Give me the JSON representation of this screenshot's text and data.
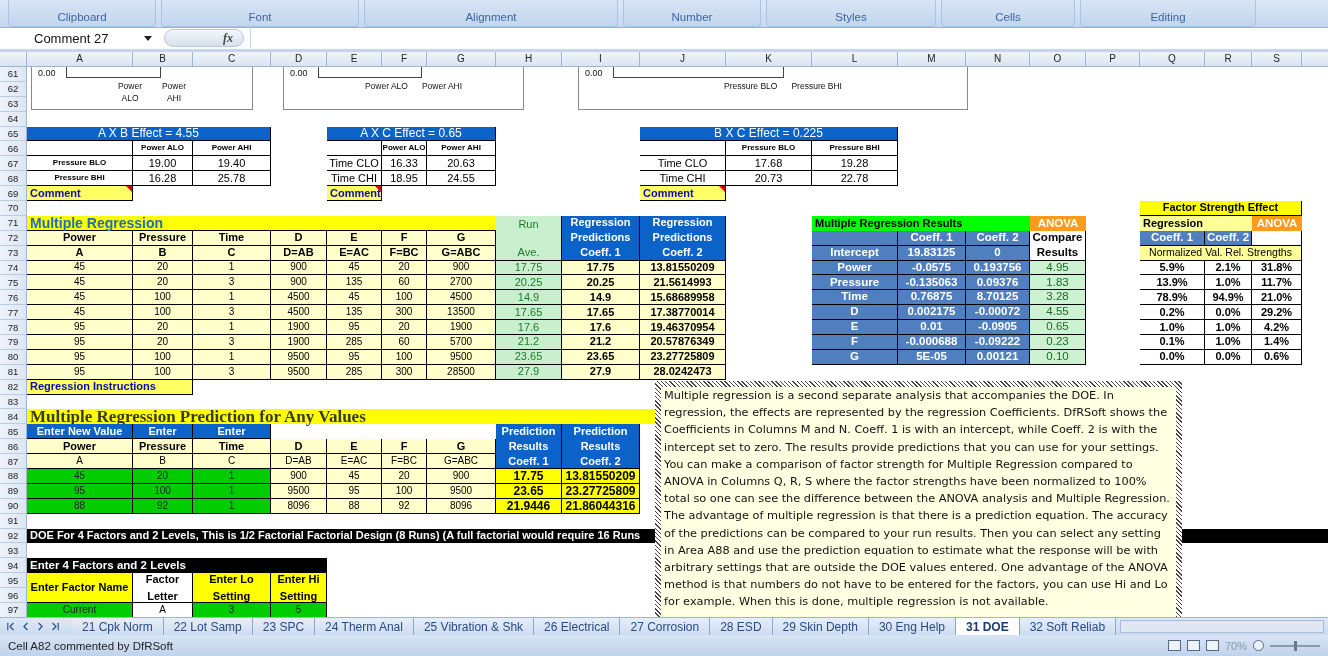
{
  "ribbon": {
    "groups": [
      "Clipboard",
      "Font",
      "Alignment",
      "Number",
      "Styles",
      "Cells",
      "Editing"
    ]
  },
  "formula_bar": {
    "name_box": "Comment 27",
    "fx_label": "fx"
  },
  "column_headers": [
    "A",
    "B",
    "C",
    "D",
    "E",
    "F",
    "G",
    "H",
    "I",
    "J",
    "K",
    "L",
    "M",
    "N",
    "O",
    "P",
    "Q",
    "R",
    "S"
  ],
  "row_numbers": [
    "61",
    "62",
    "63",
    "64",
    "65",
    "66",
    "67",
    "68",
    "69",
    "70",
    "71",
    "72",
    "73",
    "74",
    "75",
    "76",
    "77",
    "78",
    "79",
    "80",
    "81",
    "82",
    "83",
    "84",
    "85",
    "86",
    "87",
    "88",
    "89",
    "90",
    "91",
    "92",
    "93",
    "94",
    "95",
    "96",
    "97"
  ],
  "charts": [
    {
      "axis_value": "0.00",
      "x_labels": [
        "Power ALO",
        "Power AHI"
      ]
    },
    {
      "axis_value": "0.00",
      "x_labels": [
        "Power ALO",
        "Power AHI"
      ]
    },
    {
      "axis_value": "0.00",
      "x_labels": [
        "Pressure BLO",
        "Pressure BHI"
      ]
    }
  ],
  "effect_tables": [
    {
      "title": "A X B Effect = 4.55",
      "columns": [
        "Power ALO",
        "Power AHI"
      ],
      "rows": [
        {
          "label": "Pressure BLO",
          "values": [
            "19.00",
            "19.40"
          ]
        },
        {
          "label": "Pressure BHI",
          "values": [
            "16.28",
            "25.78"
          ]
        }
      ],
      "comment": "Comment"
    },
    {
      "title": "A X C Effect = 0.65",
      "columns": [
        "Power ALO",
        "Power AHI"
      ],
      "rows": [
        {
          "label": "Time CLO",
          "values": [
            "16.33",
            "20.63"
          ]
        },
        {
          "label": "Time CHI",
          "values": [
            "18.95",
            "24.55"
          ]
        }
      ],
      "comment": "Comment"
    },
    {
      "title": "B X C Effect = 0.225",
      "columns": [
        "Pressure BLO",
        "Pressure BHI"
      ],
      "rows": [
        {
          "label": "Time CLO",
          "values": [
            "17.68",
            "19.28"
          ]
        },
        {
          "label": "Time CHI",
          "values": [
            "20.73",
            "22.78"
          ]
        }
      ],
      "comment": "Comment"
    }
  ],
  "multiple_regression": {
    "title": "Multiple Regression",
    "run_header": [
      "Run",
      "Ave."
    ],
    "prediction_headers": [
      "Regression Predictions Coeff. 1",
      "Regression Predictions Coeff. 2"
    ],
    "factor_names": [
      "Power",
      "Pressure",
      "Time",
      "D",
      "E",
      "F",
      "G"
    ],
    "factor_codes": [
      "A",
      "B",
      "C",
      "D=AB",
      "E=AC",
      "F=BC",
      "G=ABC"
    ],
    "rows": [
      {
        "values": [
          "45",
          "20",
          "1",
          "900",
          "45",
          "20",
          "900"
        ],
        "run_ave": "17.75",
        "coeff_1": "17.75",
        "coeff_2": "13.81550209"
      },
      {
        "values": [
          "45",
          "20",
          "3",
          "900",
          "135",
          "60",
          "2700"
        ],
        "run_ave": "20.25",
        "coeff_1": "20.25",
        "coeff_2": "21.5614993"
      },
      {
        "values": [
          "45",
          "100",
          "1",
          "4500",
          "45",
          "100",
          "4500"
        ],
        "run_ave": "14.9",
        "coeff_1": "14.9",
        "coeff_2": "15.68689958"
      },
      {
        "values": [
          "45",
          "100",
          "3",
          "4500",
          "135",
          "300",
          "13500"
        ],
        "run_ave": "17.65",
        "coeff_1": "17.65",
        "coeff_2": "17.38770014"
      },
      {
        "values": [
          "95",
          "20",
          "1",
          "1900",
          "95",
          "20",
          "1900"
        ],
        "run_ave": "17.6",
        "coeff_1": "17.6",
        "coeff_2": "19.46370954"
      },
      {
        "values": [
          "95",
          "20",
          "3",
          "1900",
          "285",
          "60",
          "5700"
        ],
        "run_ave": "21.2",
        "coeff_1": "21.2",
        "coeff_2": "20.57876349"
      },
      {
        "values": [
          "95",
          "100",
          "1",
          "9500",
          "95",
          "100",
          "9500"
        ],
        "run_ave": "23.65",
        "coeff_1": "23.65",
        "coeff_2": "23.27725809"
      },
      {
        "values": [
          "95",
          "100",
          "3",
          "9500",
          "285",
          "300",
          "28500"
        ],
        "run_ave": "27.9",
        "coeff_1": "27.9",
        "coeff_2": "28.0242473"
      }
    ],
    "instructions": "Regression Instructions"
  },
  "regression_results": {
    "title": "Multiple Regression Results",
    "anova": "ANOVA",
    "columns": [
      "Coeff. 1",
      "Coeff. 2"
    ],
    "compare": "Compare Results",
    "rows": [
      {
        "label": "Intercept",
        "coeff_1": "19.83125",
        "coeff_2": "0"
      },
      {
        "label": "Power",
        "coeff_1": "-0.0575",
        "coeff_2": "0.193756",
        "anova": "4.95"
      },
      {
        "label": "Pressure",
        "coeff_1": "-0.135063",
        "coeff_2": "0.09376",
        "anova": "1.83"
      },
      {
        "label": "Time",
        "coeff_1": "0.76875",
        "coeff_2": "8.70125",
        "anova": "3.28"
      },
      {
        "label": "D",
        "coeff_1": "0.002175",
        "coeff_2": "-0.00072",
        "anova": "4.55"
      },
      {
        "label": "E",
        "coeff_1": "0.01",
        "coeff_2": "-0.0905",
        "anova": "0.65"
      },
      {
        "label": "F",
        "coeff_1": "-0.000688",
        "coeff_2": "-0.09222",
        "anova": "0.23"
      },
      {
        "label": "G",
        "coeff_1": "5E-05",
        "coeff_2": "0.00121",
        "anova": "0.10"
      }
    ]
  },
  "factor_strength": {
    "title": "Factor Strength Effect",
    "regression": "Regression",
    "anova": "ANOVA",
    "columns": [
      "Coeff. 1",
      "Coeff. 2"
    ],
    "note": "Normalized Val. Rel. Strengths",
    "rows": [
      [
        "5.9%",
        "2.1%",
        "31.8%"
      ],
      [
        "13.9%",
        "1.0%",
        "11.7%"
      ],
      [
        "78.9%",
        "94.9%",
        "21.0%"
      ],
      [
        "0.2%",
        "0.0%",
        "29.2%"
      ],
      [
        "1.0%",
        "1.0%",
        "4.2%"
      ],
      [
        "0.1%",
        "1.0%",
        "1.4%"
      ],
      [
        "0.0%",
        "0.0%",
        "0.6%"
      ]
    ]
  },
  "prediction": {
    "title": "Multiple Regression Prediction for Any Values",
    "enter_headers": [
      "Enter New Value",
      "Enter",
      "Enter"
    ],
    "factor_names": [
      "Power",
      "Pressure",
      "Time",
      "D",
      "E",
      "F",
      "G"
    ],
    "factor_codes": [
      "A",
      "B",
      "C",
      "D=AB",
      "E=AC",
      "F=BC",
      "G=ABC"
    ],
    "result_headers": [
      "Prediction Results Coeff. 1",
      "Prediction Results Coeff. 2"
    ],
    "rows": [
      {
        "values": [
          "45",
          "20",
          "1",
          "900",
          "45",
          "20",
          "900"
        ],
        "coeff_1": "17.75",
        "coeff_2": "13.81550209"
      },
      {
        "values": [
          "95",
          "100",
          "1",
          "9500",
          "95",
          "100",
          "9500"
        ],
        "coeff_1": "23.65",
        "coeff_2": "23.27725809"
      },
      {
        "values": [
          "88",
          "92",
          "1",
          "8096",
          "88",
          "92",
          "8096"
        ],
        "coeff_1": "21.9446",
        "coeff_2": "21.86044316"
      }
    ]
  },
  "doe_banner": "DOE For 4 Factors and 2 Levels, This is  1/2 Factorial Factorial Design (8 Runs) (A full factorial would require 16 Runs",
  "factors_table": {
    "title": "Enter 4 Factors and 2 Levels",
    "headers": [
      "Enter Factor Name",
      "Factor Letter",
      "Enter Lo Setting",
      "Enter Hi Setting"
    ],
    "rows": [
      {
        "name": "Current",
        "letter": "A",
        "lo": "3",
        "hi": "5"
      }
    ]
  },
  "comment_box": {
    "text": "Multiple regression is a second separate analysis that accompanies the DOE. In regression, the effects are represented by the regression Coefficients. DfRSoft shows the Coefficients in Columns M and N. Coeff. 1 is with an intercept, while Coeff. 2 is with the intercept set to zero. The results provide predictions that you can use for your settings. You can make a comparison of factor strength for Multiple Regression compared to ANOVA in Columns Q, R, S where the factor strengths have been normalized to 100% total so one can see the difference between the ANOVA analysis and Multiple Regression. The advantage of multiple regression is that there is a prediction equation. The accuracy of the predictions can be compared to your run results. Then you can select any setting in Area A88 and use the prediction equation to estimate what the response will be with arbitrary settings that are outside the DOE values entered. One advantage of the ANOVA method is that numbers do not have to be entered for the factors, you can use Hi and Lo for example. When this is done, multiple regression is not available."
  },
  "sheet_tabs": [
    {
      "label": "21 Cpk Norm",
      "selected": false
    },
    {
      "label": "22 Lot Samp",
      "selected": false
    },
    {
      "label": "23 SPC",
      "selected": false
    },
    {
      "label": "24 Therm Anal",
      "selected": false
    },
    {
      "label": "25 Vibration & Shk",
      "selected": false
    },
    {
      "label": "26 Electrical",
      "selected": false
    },
    {
      "label": "27 Corrosion",
      "selected": false
    },
    {
      "label": "28 ESD",
      "selected": false
    },
    {
      "label": "29 Skin Depth",
      "selected": false
    },
    {
      "label": "30 Eng Help",
      "selected": false
    },
    {
      "label": "31 DOE",
      "selected": true
    },
    {
      "label": "32 Soft Reliab",
      "selected": false
    }
  ],
  "status_bar": {
    "message": "Cell A82 commented by DfRSoft",
    "zoom": "70%",
    "zoom_slider": {
      "level": 0.5
    }
  }
}
